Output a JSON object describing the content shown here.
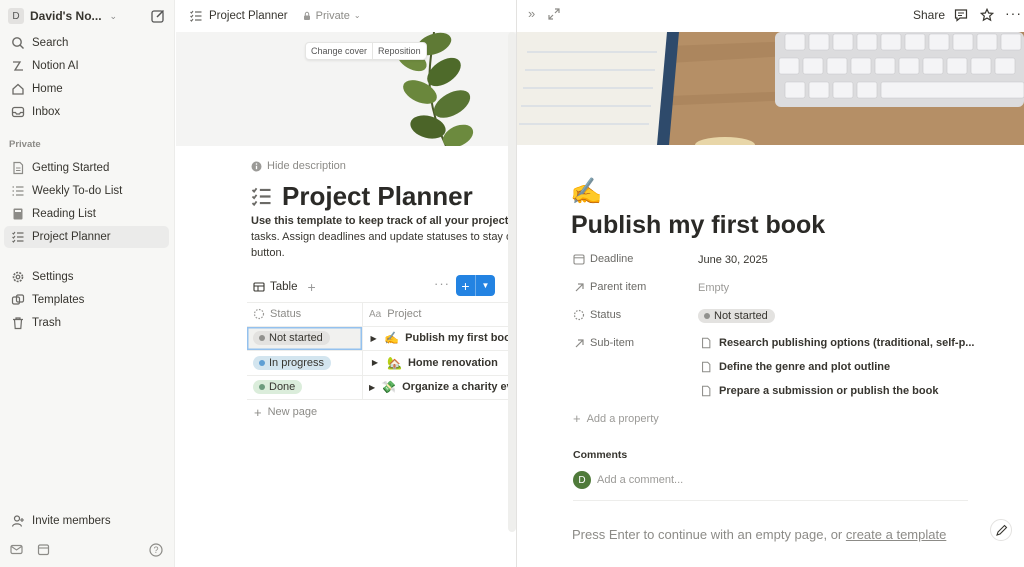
{
  "sidebar": {
    "workspace_initial": "D",
    "workspace_name": "David's No...",
    "top_items": [
      {
        "label": "Search",
        "icon": "search-icon"
      },
      {
        "label": "Notion AI",
        "icon": "notion-ai-icon"
      },
      {
        "label": "Home",
        "icon": "home-icon"
      },
      {
        "label": "Inbox",
        "icon": "inbox-icon"
      }
    ],
    "section_private": "Private",
    "pages": [
      {
        "label": "Getting Started",
        "icon": "page-icon"
      },
      {
        "label": "Weekly To-do List",
        "icon": "list-icon"
      },
      {
        "label": "Reading List",
        "icon": "book-icon"
      },
      {
        "label": "Project Planner",
        "icon": "checklist-icon",
        "active": true
      }
    ],
    "bottom_items": [
      {
        "label": "Settings",
        "icon": "gear-icon"
      },
      {
        "label": "Templates",
        "icon": "templates-icon"
      },
      {
        "label": "Trash",
        "icon": "trash-icon"
      }
    ],
    "invite_label": "Invite members"
  },
  "left_page": {
    "breadcrumb": "Project Planner",
    "privacy": "Private",
    "cover_buttons": [
      "Change cover",
      "Reposition"
    ],
    "hide_description": "Hide description",
    "title": "Project Planner",
    "description_bold": "Use this template to keep track of all your projects",
    "description_rest": "tasks. Assign deadlines and update statuses to stay o",
    "description_line3": "button.",
    "view_tab": "Table",
    "columns": {
      "status": "Status",
      "project": "Project"
    },
    "rows": [
      {
        "status": "Not started",
        "status_color": "#91918e",
        "tag_bg": "#e3e2e0",
        "emoji": "✍️",
        "project": "Publish my first book"
      },
      {
        "status": "In progress",
        "status_color": "#5e9fd4",
        "tag_bg": "#d3e5ef",
        "emoji": "🏡",
        "project": "Home renovation"
      },
      {
        "status": "Done",
        "status_color": "#6c9b7d",
        "tag_bg": "#dbeddb",
        "emoji": "💸",
        "project": "Organize a charity event"
      }
    ],
    "new_page": "New page"
  },
  "right_panel": {
    "share": "Share",
    "emoji": "✍️",
    "title": "Publish my first book",
    "properties": {
      "deadline_label": "Deadline",
      "deadline_value": "June 30, 2025",
      "parent_label": "Parent item",
      "parent_value": "Empty",
      "status_label": "Status",
      "status_value": "Not started",
      "subitem_label": "Sub-item",
      "subitems": [
        "Research publishing options (traditional, self-p...",
        "Define the genre and plot outline",
        "Prepare a submission or publish the book"
      ]
    },
    "add_property": "Add a property",
    "comments_label": "Comments",
    "commenter_initial": "D",
    "comment_placeholder": "Add a comment...",
    "hint_text": "Press Enter to continue with an empty page, or ",
    "hint_link": "create a template"
  }
}
